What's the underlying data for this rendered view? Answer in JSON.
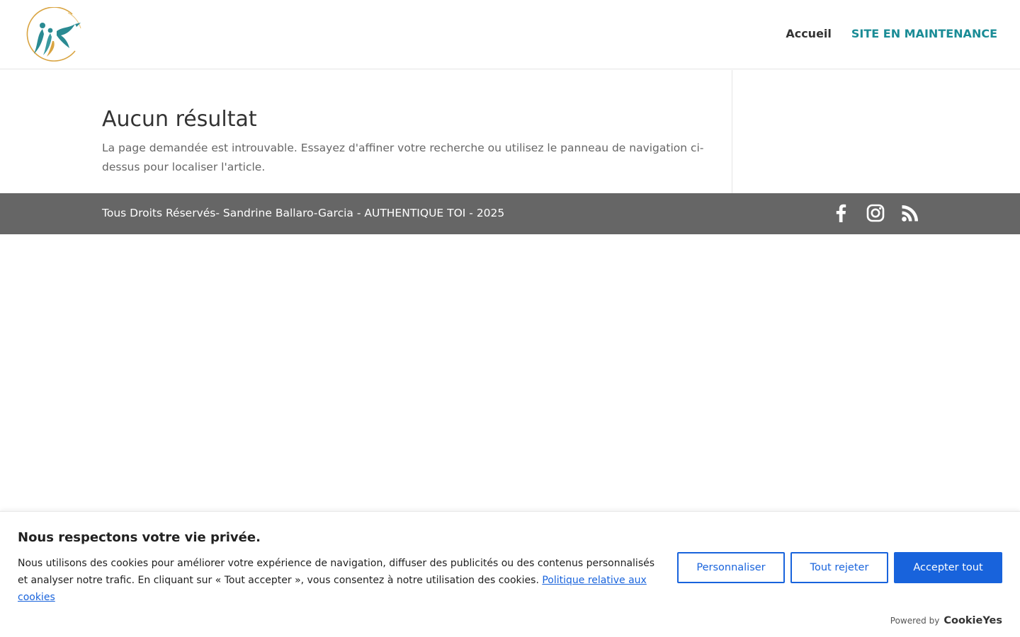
{
  "header": {
    "nav": [
      {
        "label": "Accueil"
      },
      {
        "label": "SITE EN MAINTENANCE"
      }
    ]
  },
  "main": {
    "title": "Aucun résultat",
    "description": "La page demandée est introuvable. Essayez d'affiner votre recherche ou utilisez le panneau de navigation ci-dessus pour localiser l'article."
  },
  "footer": {
    "text": "Tous Droits Réservés- Sandrine Ballaro-Garcia - AUTHENTIQUE TOI - 2025",
    "socials": [
      "facebook-icon",
      "instagram-icon",
      "rss-icon"
    ]
  },
  "cookie": {
    "title": "Nous respectons votre vie privée.",
    "text": "Nous utilisons des cookies pour améliorer votre expérience de navigation, diffuser des publicités ou des contenus personnalisés et analyser notre trafic. En cliquant sur « Tout accepter », vous consentez à notre utilisation des cookies.",
    "policy_link": "Politique relative aux cookies",
    "buttons": {
      "customize": "Personnaliser",
      "reject": "Tout rejeter",
      "accept": "Accepter tout"
    },
    "powered_label": "Powered by",
    "powered_brand": "CookieYes"
  },
  "colors": {
    "accent": "#1a8c96",
    "footer_bg": "#666666",
    "cookie_primary": "#1863dc"
  }
}
